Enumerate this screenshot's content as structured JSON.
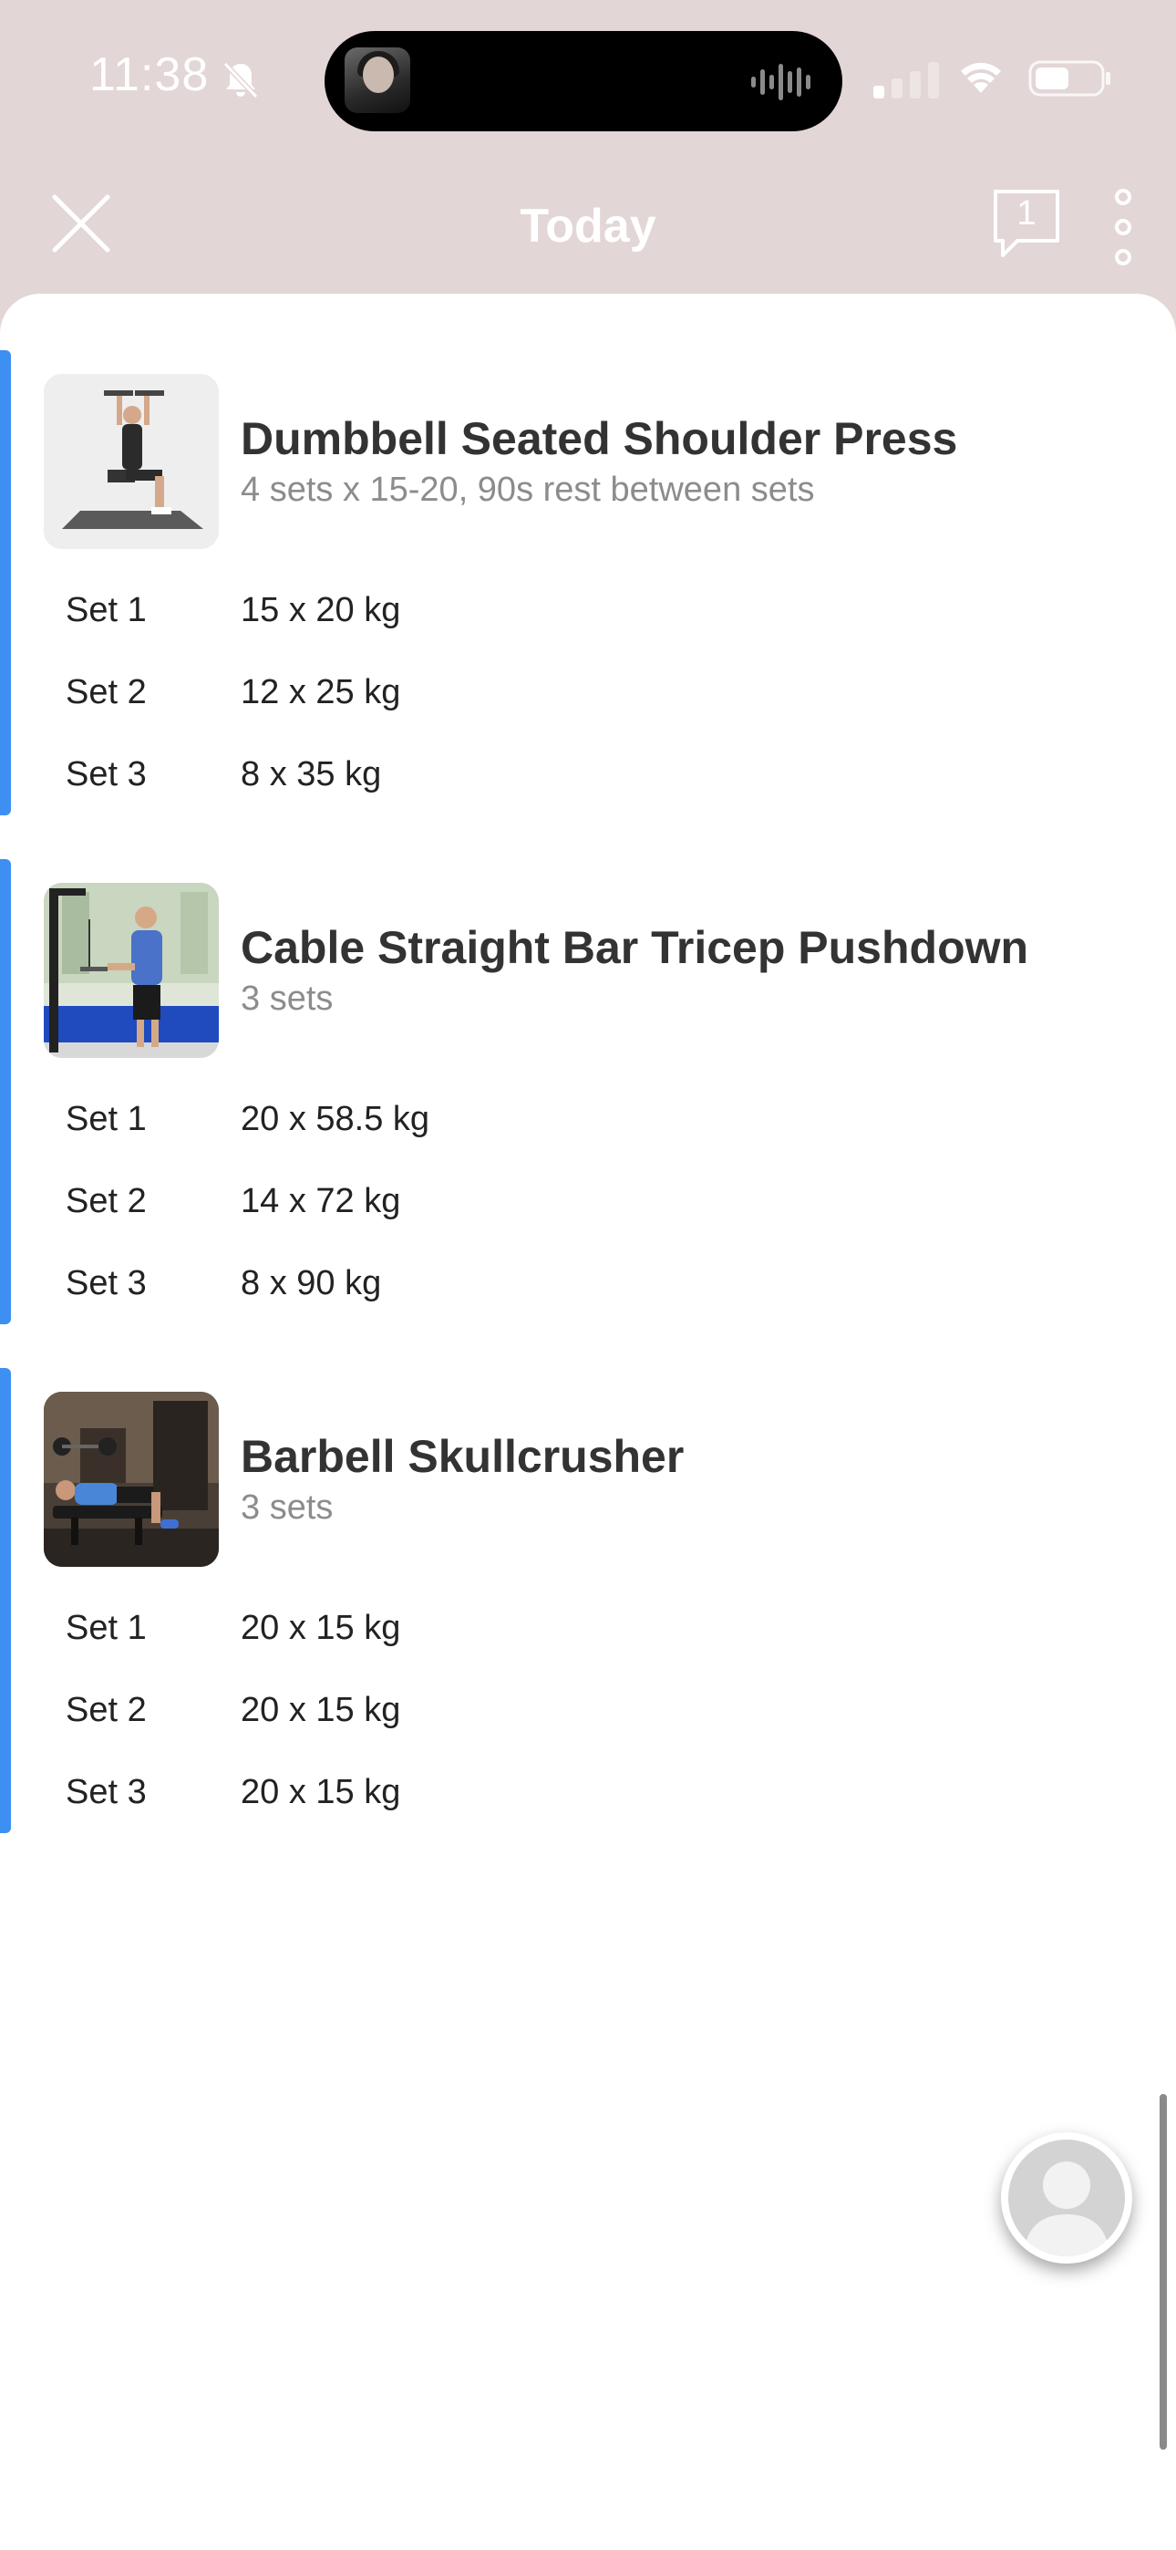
{
  "status_bar": {
    "time": "11:38",
    "icons": [
      "bell-slash-icon",
      "signal-icon",
      "wifi-icon",
      "battery-icon"
    ]
  },
  "nav": {
    "title": "Today",
    "chat_count": "1",
    "icons": [
      "close-icon",
      "chat-bubble-icon",
      "more-vertical-icon"
    ]
  },
  "colors": {
    "header_bg": "#e3d6d6",
    "accent": "#3d8ff2",
    "title_text": "#333333",
    "subtitle_text": "#8c8c8c"
  },
  "exercises": [
    {
      "title": "Dumbbell Seated Shoulder Press",
      "subtitle": "4 sets x 15-20, 90s rest between sets",
      "sets": [
        {
          "label": "Set 1",
          "value": "15 x 20 kg"
        },
        {
          "label": "Set 2",
          "value": "12 x 25 kg"
        },
        {
          "label": "Set 3",
          "value": "8 x 35 kg"
        }
      ]
    },
    {
      "title": "Cable Straight Bar Tricep Pushdown",
      "subtitle": "3 sets",
      "sets": [
        {
          "label": "Set 1",
          "value": "20 x 58.5 kg"
        },
        {
          "label": "Set 2",
          "value": "14 x 72 kg"
        },
        {
          "label": "Set 3",
          "value": "8 x 90 kg"
        }
      ]
    },
    {
      "title": "Barbell Skullcrusher",
      "subtitle": "3 sets",
      "sets": [
        {
          "label": "Set 1",
          "value": "20 x 15 kg"
        },
        {
          "label": "Set 2",
          "value": "20 x 15 kg"
        },
        {
          "label": "Set 3",
          "value": "20 x 15 kg"
        }
      ]
    }
  ]
}
